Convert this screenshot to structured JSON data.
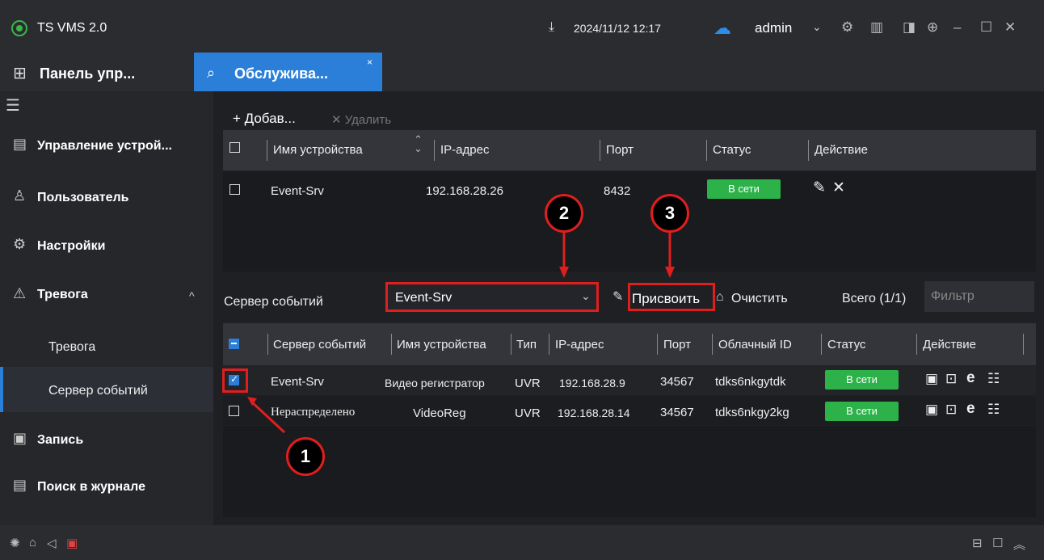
{
  "app": {
    "title": "TS VMS 2.0",
    "datetime": "2024/11/12 12:17",
    "user": "admin"
  },
  "tabs": [
    {
      "label": "Панель упр..."
    },
    {
      "label": "Обслужива...",
      "close": "×"
    }
  ],
  "sidebar": {
    "items": [
      {
        "label": "Управление устрой..."
      },
      {
        "label": "Пользователь"
      },
      {
        "label": "Настройки"
      },
      {
        "label": "Тревога",
        "expand": "^"
      },
      {
        "label": "Тревога"
      },
      {
        "label": "Сервер событий"
      },
      {
        "label": "Запись"
      },
      {
        "label": "Поиск в журнале"
      }
    ]
  },
  "toolbar": {
    "add": "+ Добав...",
    "delete": "✕ Удалить"
  },
  "table1": {
    "headers": [
      "Имя устройства",
      "IP-адрес",
      "Порт",
      "Статус",
      "Действие"
    ],
    "rows": [
      {
        "name": "Event-Srv",
        "ip": "192.168.28.26",
        "port": "8432",
        "status": "В сети"
      }
    ]
  },
  "event_server": {
    "label": "Сервер событий",
    "selected": "Event-Srv",
    "assign": "Присвоить",
    "clear": "Очистить",
    "total": "Всего (1/1)",
    "filter_placeholder": "Фильтр"
  },
  "table2": {
    "headers": [
      "Сервер событий",
      "Имя устройства",
      "Тип",
      "IP-адрес",
      "Порт",
      "Облачный ID",
      "Статус",
      "Действие"
    ],
    "rows": [
      {
        "server": "Event-Srv",
        "name": "Видео регистратор",
        "type": "UVR",
        "ip": "192.168.28.9",
        "port": "34567",
        "cloud": "tdks6nkgytdk",
        "status": "В сети",
        "checked": true
      },
      {
        "server": "Нераспределено",
        "name": "VideoReg",
        "type": "UVR",
        "ip": "192.168.28.14",
        "port": "34567",
        "cloud": "tdks6nkgy2kg",
        "status": "В сети",
        "checked": false
      }
    ]
  },
  "annotations": [
    "1",
    "2",
    "3"
  ],
  "colors": {
    "accent": "#2c7fd9",
    "online": "#2db24a",
    "annotation": "#e01e1e"
  }
}
